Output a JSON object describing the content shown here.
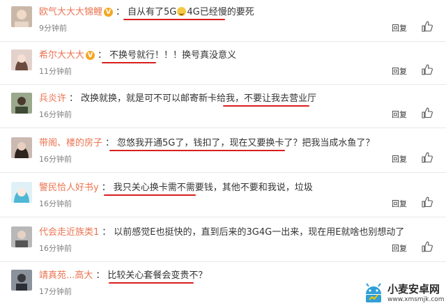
{
  "comments": [
    {
      "name": "欧气大大大锦鲤",
      "verified": true,
      "text": "自从有了5G",
      "emoji": "laugh-cry-emoji",
      "text_after": "4G已经慢的要死",
      "time": "9分钟前",
      "avatar_color": "#c9b8a8"
    },
    {
      "name": "希尔大大大",
      "verified": true,
      "text": "不换号就行！！！换号真没意义",
      "time": "11分钟前",
      "avatar_color": "#d9c7c0"
    },
    {
      "name": "兵炎许",
      "verified": false,
      "text": "改换就换，就是可不可以邮寄新卡给我，不要让我去营业厅",
      "time": "16分钟前",
      "avatar_color": "#7a8a6a"
    },
    {
      "name": "带阁、楼的房子",
      "verified": false,
      "text": "忽悠我开通5G了，钱扣了，现在又要换卡了？把我当成水鱼了？",
      "time": "16分钟前",
      "avatar_color": "#5a4a44"
    },
    {
      "name": "警民恰人好书y",
      "verified": false,
      "text": "我只关心换卡需不需要钱，其他不要和我说，垃圾",
      "time": "16分钟前",
      "avatar_color": "#7fc7d9"
    },
    {
      "name": "代会走近族类1",
      "verified": false,
      "text": "以前感觉E也挺快的，直到后来的3G4G一出来，现在用E就啥也别想动了",
      "time": "16分钟前",
      "avatar_color": "#8a8a8a"
    },
    {
      "name": "靖真苑...高大",
      "verified": false,
      "text": "比较关心套餐会变贵不？",
      "time": "17分钟前",
      "avatar_color": "#6a6f78"
    }
  ],
  "reply_label": "回复",
  "verified_mark": "V",
  "separator": "：",
  "watermark": {
    "title": "小麦安卓网",
    "url": "www.xmsmjk.com"
  },
  "colors": {
    "name": "#eb7350",
    "underline": "#d81e1e"
  }
}
